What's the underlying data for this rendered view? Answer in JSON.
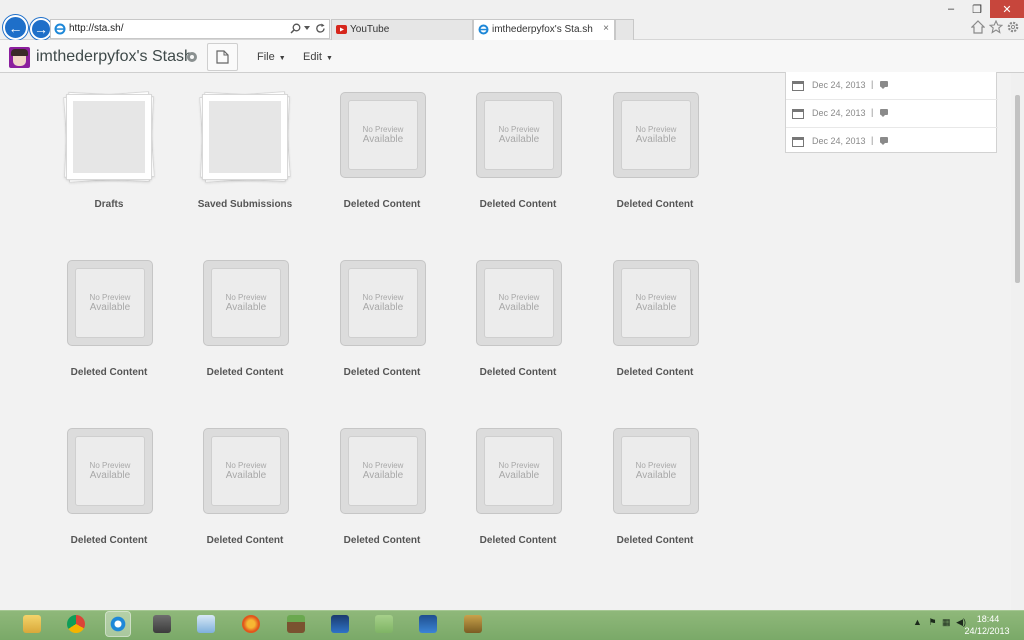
{
  "browser": {
    "url": "http://sta.sh/",
    "tabs": [
      {
        "label": "YouTube"
      },
      {
        "label": "imthederpyfox's Sta.sh"
      }
    ],
    "tab_close": "×",
    "back_glyph": "←",
    "forward_glyph": "→",
    "window_controls": {
      "minimize": "–",
      "maximize": "❐",
      "close": "✕"
    },
    "icons": [
      "home-icon",
      "star-icon",
      "gear-icon",
      "search-icon",
      "refresh-icon"
    ]
  },
  "stash": {
    "username": "imthederpyfox's",
    "brand": "Stash",
    "menus": [
      {
        "label": "File"
      },
      {
        "label": "Edit"
      }
    ]
  },
  "gallery": {
    "items": [
      {
        "label": "Drafts",
        "kind": "folder"
      },
      {
        "label": "Saved Submissions",
        "kind": "folder"
      },
      {
        "label": "Deleted Content",
        "kind": "deleted"
      },
      {
        "label": "Deleted Content",
        "kind": "deleted"
      },
      {
        "label": "Deleted Content",
        "kind": "deleted"
      },
      {
        "label": "Deleted Content",
        "kind": "deleted"
      },
      {
        "label": "Deleted Content",
        "kind": "deleted"
      },
      {
        "label": "Deleted Content",
        "kind": "deleted"
      },
      {
        "label": "Deleted Content",
        "kind": "deleted"
      },
      {
        "label": "Deleted Content",
        "kind": "deleted"
      },
      {
        "label": "Deleted Content",
        "kind": "deleted"
      },
      {
        "label": "Deleted Content",
        "kind": "deleted"
      },
      {
        "label": "Deleted Content",
        "kind": "deleted"
      },
      {
        "label": "Deleted Content",
        "kind": "deleted"
      },
      {
        "label": "Deleted Content",
        "kind": "deleted"
      }
    ],
    "no_preview": {
      "line1": "No Preview",
      "line2": "Available"
    }
  },
  "side_panel": {
    "rows": [
      {
        "date": "Dec 24, 2013",
        "separator": "|"
      },
      {
        "date": "Dec 24, 2013",
        "separator": "|"
      },
      {
        "date": "Dec 24, 2013",
        "separator": "|"
      }
    ]
  },
  "taskbar": {
    "apps": [
      "file-explorer",
      "chrome",
      "internet-explorer",
      "gimp",
      "paint",
      "firefox",
      "minecraft",
      "app-blue",
      "fb-app",
      "app-blue-2",
      "app-gear"
    ],
    "active_app": "internet-explorer",
    "time": "18:44",
    "date": "24/12/2013"
  },
  "colors": {
    "accent_blue": "#1e6fc9",
    "close_red": "#c7463c",
    "taskbar_green": "#7aa968",
    "avatar_purple": "#8b1f9e"
  }
}
